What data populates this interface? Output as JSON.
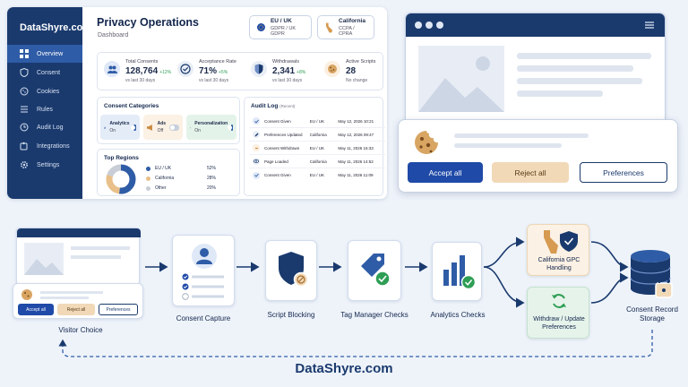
{
  "dashboard": {
    "brand": "DataShyre.com",
    "nav": [
      "Overview",
      "Consent",
      "Cookies",
      "Rules",
      "Audit Log",
      "Integrations",
      "Settings"
    ],
    "title": "Privacy Operations",
    "subtitle": "Dashboard",
    "chips": [
      {
        "title": "EU / UK",
        "sub": "GDPR / UK GDPR"
      },
      {
        "title": "California",
        "sub": "CCPA / CPRA"
      }
    ],
    "kpis": [
      {
        "label": "Total Consents",
        "value": "128,764",
        "delta": "+12%",
        "sub": "vs last 30 days"
      },
      {
        "label": "Acceptance Rate",
        "value": "71%",
        "delta": "+5%",
        "sub": "vs last 30 days"
      },
      {
        "label": "Withdrawals",
        "value": "2,341",
        "delta": "+8%",
        "sub": "vs last 30 days"
      },
      {
        "label": "Active Scripts",
        "value": "28",
        "delta": "",
        "sub": "No change"
      }
    ],
    "categories_title": "Consent Categories",
    "categories": [
      {
        "name": "Analytics",
        "state": "On"
      },
      {
        "name": "Ads",
        "state": "Off"
      },
      {
        "name": "Personalization",
        "state": "On"
      }
    ],
    "regions_title": "Top Regions",
    "regions": [
      {
        "name": "EU / UK",
        "pct": "52%",
        "value": 52,
        "color": "#2f5ca6"
      },
      {
        "name": "California",
        "pct": "28%",
        "value": 28,
        "color": "#e9c08a"
      },
      {
        "name": "Other",
        "pct": "20%",
        "value": 20,
        "color": "#c8cdd6"
      }
    ],
    "audit_title": "Audit Log",
    "audit_sub": "(Recent)",
    "audit": [
      {
        "event": "Consent Given",
        "region": "EU / UK",
        "time": "May 12, 2026 10:21"
      },
      {
        "event": "Preferences Updated",
        "region": "California",
        "time": "May 12, 2026 09:47"
      },
      {
        "event": "Consent Withdrawn",
        "region": "EU / UK",
        "time": "May 11, 2026 16:33"
      },
      {
        "event": "Page Loaded",
        "region": "California",
        "time": "May 11, 2026 14:52"
      },
      {
        "event": "Consent Given",
        "region": "EU / UK",
        "time": "May 11, 2026 11:09"
      }
    ]
  },
  "banner": {
    "accept": "Accept all",
    "reject": "Reject all",
    "preferences": "Preferences"
  },
  "flow": {
    "mini_accept": "Accept all",
    "mini_reject": "Reject all",
    "mini_preferences": "Preferences",
    "steps": {
      "visitor": "Visitor Choice",
      "capture": "Consent Capture",
      "blocking": "Script Blocking",
      "tag_manager": "Tag Manager Checks",
      "analytics": "Analytics Checks",
      "gpc": "California GPC Handling",
      "withdraw": "Withdraw / Update Preferences",
      "storage": "Consent Record Storage"
    },
    "brand": "DataShyre.com"
  },
  "colors": {
    "navy": "#1a3a6e",
    "blue": "#2f5ca6",
    "accent_light": "#e9c08a",
    "green": "#2e9e55"
  }
}
